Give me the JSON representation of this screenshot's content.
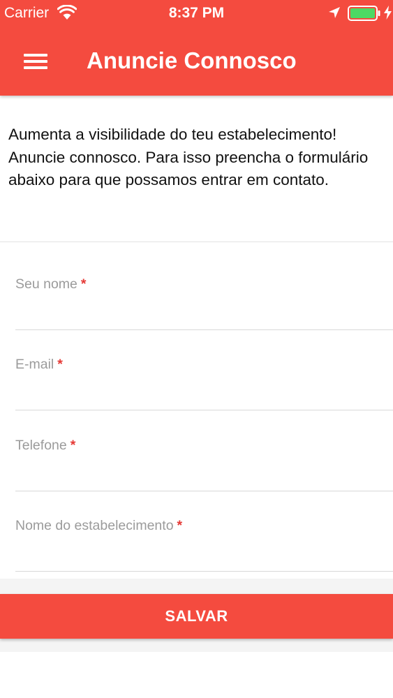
{
  "status_bar": {
    "carrier": "Carrier",
    "time": "8:37 PM",
    "battery_color": "#4cd964"
  },
  "header": {
    "title": "Anuncie Connosco",
    "background_color": "#f44b3f",
    "menu_icon": "hamburger-menu-icon"
  },
  "intro_text": "Aumenta a visibilidade do teu estabelecimento! Anuncie connosco. Para isso preencha o formulário abaixo para que possamos entrar em contato.",
  "form": {
    "required_marker": "*",
    "required_color": "#e53935",
    "fields": [
      {
        "label": "Seu nome",
        "value": "",
        "type": "text"
      },
      {
        "label": "E-mail",
        "value": "",
        "type": "email"
      },
      {
        "label": "Telefone",
        "value": "",
        "type": "tel"
      },
      {
        "label": "Nome do estabelecimento",
        "value": "",
        "type": "text"
      }
    ]
  },
  "save_button": {
    "label": "SALVAR"
  }
}
